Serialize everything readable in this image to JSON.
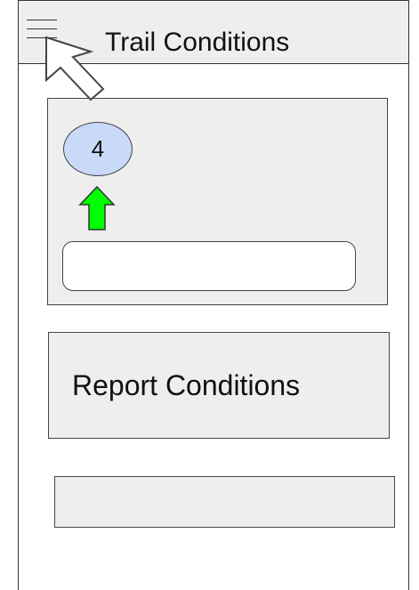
{
  "header": {
    "title": "Trail Conditions",
    "menu_icon": "hamburger-menu-icon"
  },
  "status_card": {
    "count": "4",
    "count_circle_color": "#c9daf8",
    "upvote_icon": "green-up-arrow-icon",
    "upvote_color": "#00ff00",
    "comment_value": "",
    "comment_placeholder": ""
  },
  "report_button": {
    "label": "Report Conditions"
  },
  "colors": {
    "panel_background": "#eeeeee",
    "border": "#444444"
  },
  "cursor": {
    "icon": "mouse-pointer-arrow-icon"
  }
}
